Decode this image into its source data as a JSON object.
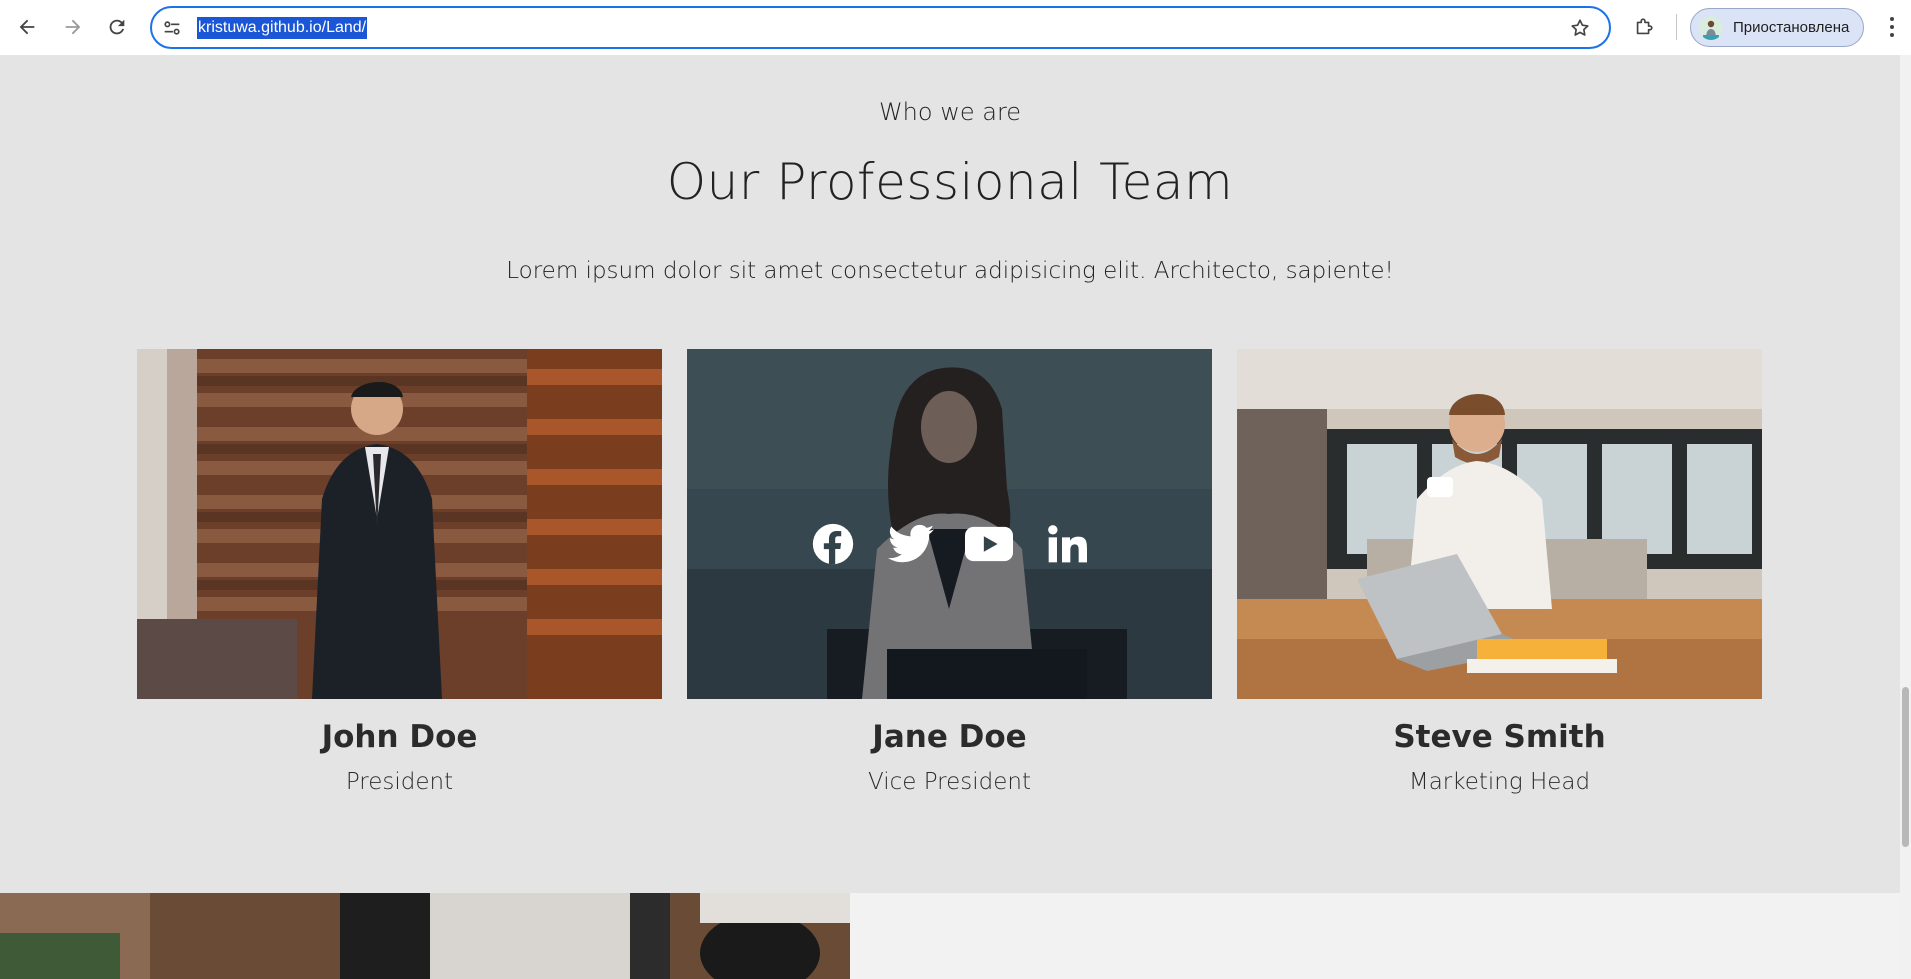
{
  "browser": {
    "url": "kristuwa.github.io/Land/",
    "profile_label": "Приостановлена",
    "icons": {
      "back": "arrow-left-icon",
      "forward": "arrow-right-icon",
      "reload": "reload-icon",
      "site_settings": "tune-icon",
      "bookmark": "star-icon",
      "extensions": "puzzle-icon",
      "menu": "kebab-menu-icon"
    }
  },
  "team": {
    "eyebrow": "Who we are",
    "title": "Our Professional Team",
    "lead": "Lorem ipsum dolor sit amet consectetur adipisicing elit. Architecto, sapiente!",
    "members": [
      {
        "name": "John Doe",
        "role": "President"
      },
      {
        "name": "Jane Doe",
        "role": "Vice President"
      },
      {
        "name": "Steve Smith",
        "role": "Marketing Head"
      }
    ],
    "social_icons": [
      "facebook-icon",
      "twitter-icon",
      "youtube-icon",
      "linkedin-icon"
    ]
  },
  "colors": {
    "section_bg": "#e4e4e4",
    "text": "#222222",
    "omnibox_focus": "#1a73e8",
    "url_selection": "#1a56d6"
  }
}
